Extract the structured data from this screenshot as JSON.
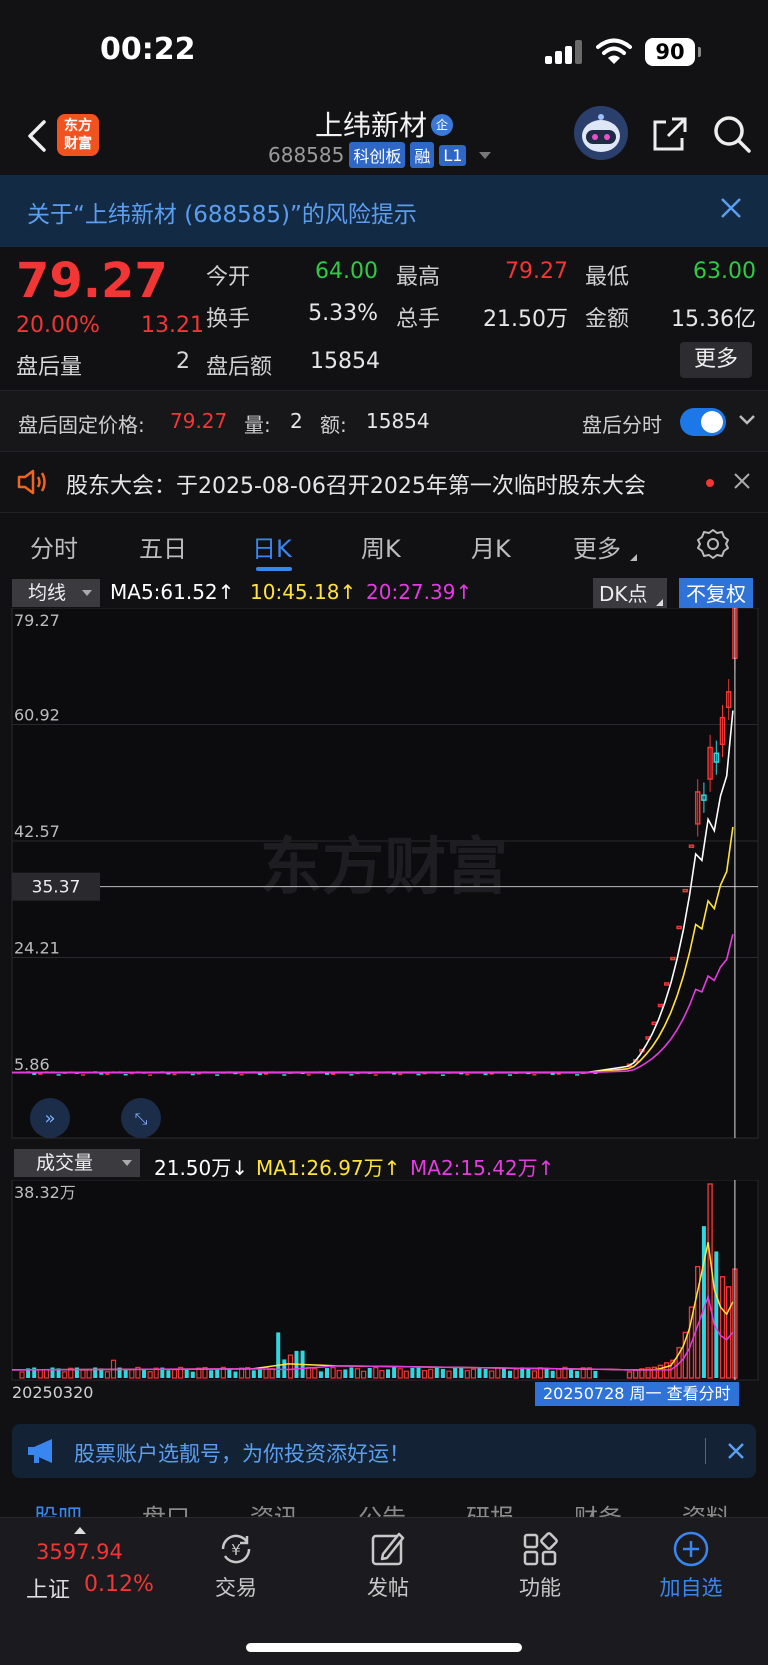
{
  "status": {
    "time": "00:22",
    "battery": "90"
  },
  "header": {
    "logo_line1": "东方",
    "logo_line2": "财富",
    "name": "上纬新材",
    "name_badge": "企",
    "code": "688585",
    "tags": [
      "科创板",
      "融",
      "L1"
    ]
  },
  "risk_banner": {
    "text": "关于“上纬新材 (688585)”的风险提示"
  },
  "quote": {
    "price": "79.27",
    "change_pct": "20.00%",
    "change": "13.21",
    "after_hours_volume_label": "盘后量",
    "after_hours_volume": "2",
    "fields": [
      {
        "label": "今开",
        "value": "64.00",
        "color": "#2fcb45"
      },
      {
        "label": "最高",
        "value": "79.27",
        "color": "#f23535"
      },
      {
        "label": "最低",
        "value": "63.00",
        "color": "#2fcb45"
      },
      {
        "label": "换手",
        "value": "5.33%",
        "color": "#e6e6e6"
      },
      {
        "label": "总手",
        "value": "21.50万",
        "color": "#e6e6e6"
      },
      {
        "label": "金额",
        "value": "15.36亿",
        "color": "#e6e6e6"
      },
      {
        "label": "盘后额",
        "value": "15854",
        "color": "#e6e6e6"
      }
    ],
    "more_label": "更多"
  },
  "fixed_price": {
    "label": "盘后固定价格:",
    "price": "79.27",
    "vol_label": "量:",
    "vol": "2",
    "amt_label": "额:",
    "amt": "15854",
    "toggle_label": "盘后分时",
    "toggle_on": true
  },
  "notice": {
    "text": "股东大会：于2025-08-06召开2025年第一次临时股东大会"
  },
  "tabs": [
    {
      "label": "分时",
      "active": false
    },
    {
      "label": "五日",
      "active": false
    },
    {
      "label": "日K",
      "active": true
    },
    {
      "label": "周K",
      "active": false
    },
    {
      "label": "月K",
      "active": false
    },
    {
      "label": "更多",
      "active": false
    }
  ],
  "ma_bar": {
    "select": "均线",
    "ma5": "MA5:61.52↑",
    "ma10": "10:45.18↑",
    "ma20": "20:27.39↑",
    "dk": "DK点",
    "fq": "不复权",
    "colors": {
      "ma5": "#ffffff",
      "ma10": "#ffe33a",
      "ma20": "#e43ce0"
    }
  },
  "vol_bar": {
    "select": "成交量",
    "vol": "21.50万↓",
    "ma1": "MA1:26.97万↑",
    "ma2": "MA2:15.42万↑"
  },
  "chart_data": {
    "type": "candlestick",
    "y_ticks": [
      "79.27",
      "60.92",
      "42.57",
      "24.21",
      "5.86"
    ],
    "ylim": [
      5.86,
      79.27
    ],
    "crosshair_label": "35.37",
    "crosshair_value": 35.37,
    "watermark": "东方财富",
    "date_start": "20250320",
    "date_end": "20250728 周一 查看分时",
    "volume_max_label": "38.32万",
    "volume_max": 38.32,
    "late_closes": [
      7.4,
      8.1,
      9.7,
      11.7,
      14.0,
      16.8,
      20.2,
      24.2,
      29.1,
      34.9,
      41.9,
      50.3,
      49.0,
      57.3,
      55.0,
      62.0,
      66.06,
      79.27
    ],
    "late_volumes": [
      1.2,
      1.5,
      1.8,
      2.0,
      2.1,
      2.5,
      3.0,
      3.5,
      6.0,
      9.0,
      14.0,
      22.0,
      30.0,
      38.32,
      25.0,
      20.0,
      18.0,
      21.5
    ]
  },
  "ad": {
    "text": "股票账户选靓号，为你投资添好运！"
  },
  "subtabs": [
    "股吧",
    "盘口",
    "资讯",
    "公告",
    "研报",
    "财务",
    "资料"
  ],
  "bottom_nav": {
    "index_value": "3597.94",
    "index_name": "上证",
    "index_pct": "0.12%",
    "items": [
      "交易",
      "发帖",
      "功能",
      "加自选"
    ]
  }
}
